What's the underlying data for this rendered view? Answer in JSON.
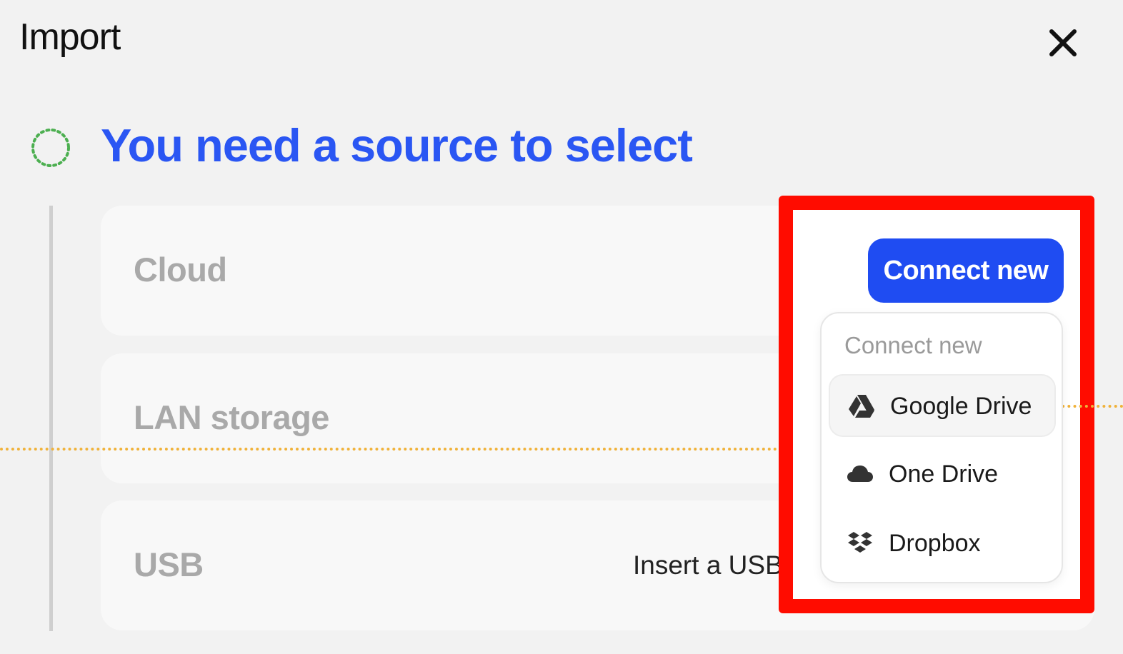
{
  "dialog": {
    "title": "Import",
    "close_icon": "close-icon"
  },
  "step": {
    "icon": "dotted-circle-icon",
    "headline": "You need a source to select"
  },
  "sources": [
    {
      "label": "Cloud"
    },
    {
      "label": "LAN storage"
    },
    {
      "label": "USB",
      "hint": "Insert a USB de"
    }
  ],
  "connect": {
    "button_label": "Connect new",
    "menu_header": "Connect new",
    "items": [
      {
        "label": "Google Drive",
        "icon": "google-drive-icon",
        "active": true
      },
      {
        "label": "One Drive",
        "icon": "cloud-icon",
        "active": false
      },
      {
        "label": "Dropbox",
        "icon": "dropbox-icon",
        "active": false
      }
    ]
  },
  "colors": {
    "accent": "#1f4cf2",
    "headline": "#2a56f3",
    "highlight_border": "#ff0c00",
    "guide_line": "#f0b23a",
    "step_circle": "#4caf50"
  }
}
